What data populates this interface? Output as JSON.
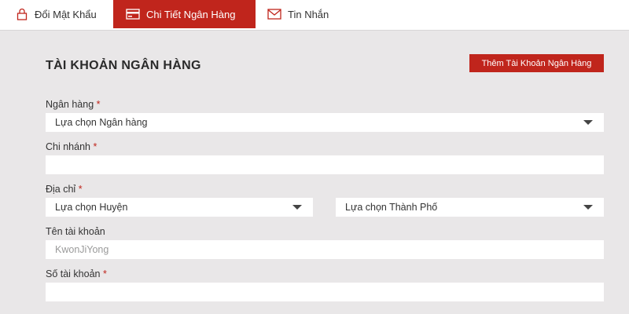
{
  "tabs": [
    {
      "label": "Đổi Mật Khẩu",
      "icon": "lock-icon",
      "active": false
    },
    {
      "label": "Chi Tiết Ngân Hàng",
      "icon": "card-icon",
      "active": true
    },
    {
      "label": "Tin Nhắn",
      "icon": "mail-icon",
      "active": false
    }
  ],
  "section": {
    "title": "TÀI KHOẢN NGÂN HÀNG",
    "add_button": "Thêm Tài Khoản Ngân Hàng"
  },
  "form": {
    "bank": {
      "label": "Ngân hàng",
      "required": "*",
      "selected": "Lựa chọn Ngân hàng"
    },
    "branch": {
      "label": "Chi nhánh",
      "required": "*",
      "value": ""
    },
    "address": {
      "label": "Địa chỉ",
      "required": "*",
      "district": "Lựa chọn Huyện",
      "city": "Lựa chọn Thành Phố"
    },
    "account_name": {
      "label": "Tên tài khoản",
      "placeholder": "KwonJiYong"
    },
    "account_number": {
      "label": "Số tài khoản",
      "required": "*",
      "value": ""
    }
  },
  "colors": {
    "accent": "#c0251c",
    "background": "#e9e7e8"
  }
}
